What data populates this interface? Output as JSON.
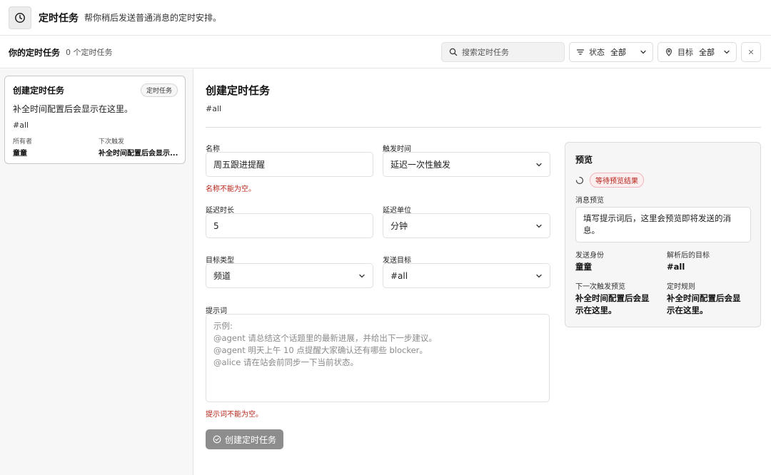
{
  "header": {
    "icon": "clock-icon",
    "title": "定时任务",
    "subtitle": "帮你稍后发送普通消息的定时安排。"
  },
  "toolbar": {
    "title": "你的定时任务",
    "count": "0 个定时任务",
    "search_placeholder": "搜索定时任务",
    "status_label": "状态",
    "status_value": "全部",
    "target_label": "目标",
    "target_value": "全部"
  },
  "sidebar": {
    "card": {
      "title": "创建定时任务",
      "badge": "定时任务",
      "description": "补全时间配置后会显示在这里。",
      "tag": "#all",
      "owner_label": "所有者",
      "owner_value": "童童",
      "next_label": "下次触发",
      "next_value": "补全时间配置后会显示..."
    }
  },
  "form": {
    "title": "创建定时任务",
    "tag": "#all",
    "name_label": "名称",
    "name_value": "周五跟进提醒",
    "name_error": "名称不能为空。",
    "trigger_label": "触发时间",
    "trigger_value": "延迟一次性触发",
    "delay_label": "延迟时长",
    "delay_value": "5",
    "unit_label": "延迟单位",
    "unit_value": "分钟",
    "target_type_label": "目标类型",
    "target_type_value": "频道",
    "send_target_label": "发送目标",
    "send_target_value": "#all",
    "prompt_label": "提示词",
    "prompt_placeholder": [
      "示例:",
      "@agent 请总结这个话题里的最新进展，并给出下一步建议。",
      "@agent 明天上午 10 点提醒大家确认还有哪些 blocker。",
      "@alice 请在站会前同步一下当前状态。"
    ],
    "prompt_error": "提示词不能为空。",
    "submit_label": "创建定时任务"
  },
  "preview": {
    "title": "预览",
    "status_badge": "等待预览结果",
    "message_label": "消息预览",
    "message_line1": "填写提示词后，这里会预览即将发送的消",
    "message_line2": "息。",
    "sender_label": "发送身份",
    "sender_value": "童童",
    "resolved_label": "解析后的目标",
    "resolved_value": "#all",
    "next_label": "下一次触发预览",
    "next_line1": "补全时间配置后会显",
    "next_line2": "示在这里。",
    "rule_label": "定时规则",
    "rule_line1": "补全时间配置后会显",
    "rule_line2": "示在这里。"
  }
}
